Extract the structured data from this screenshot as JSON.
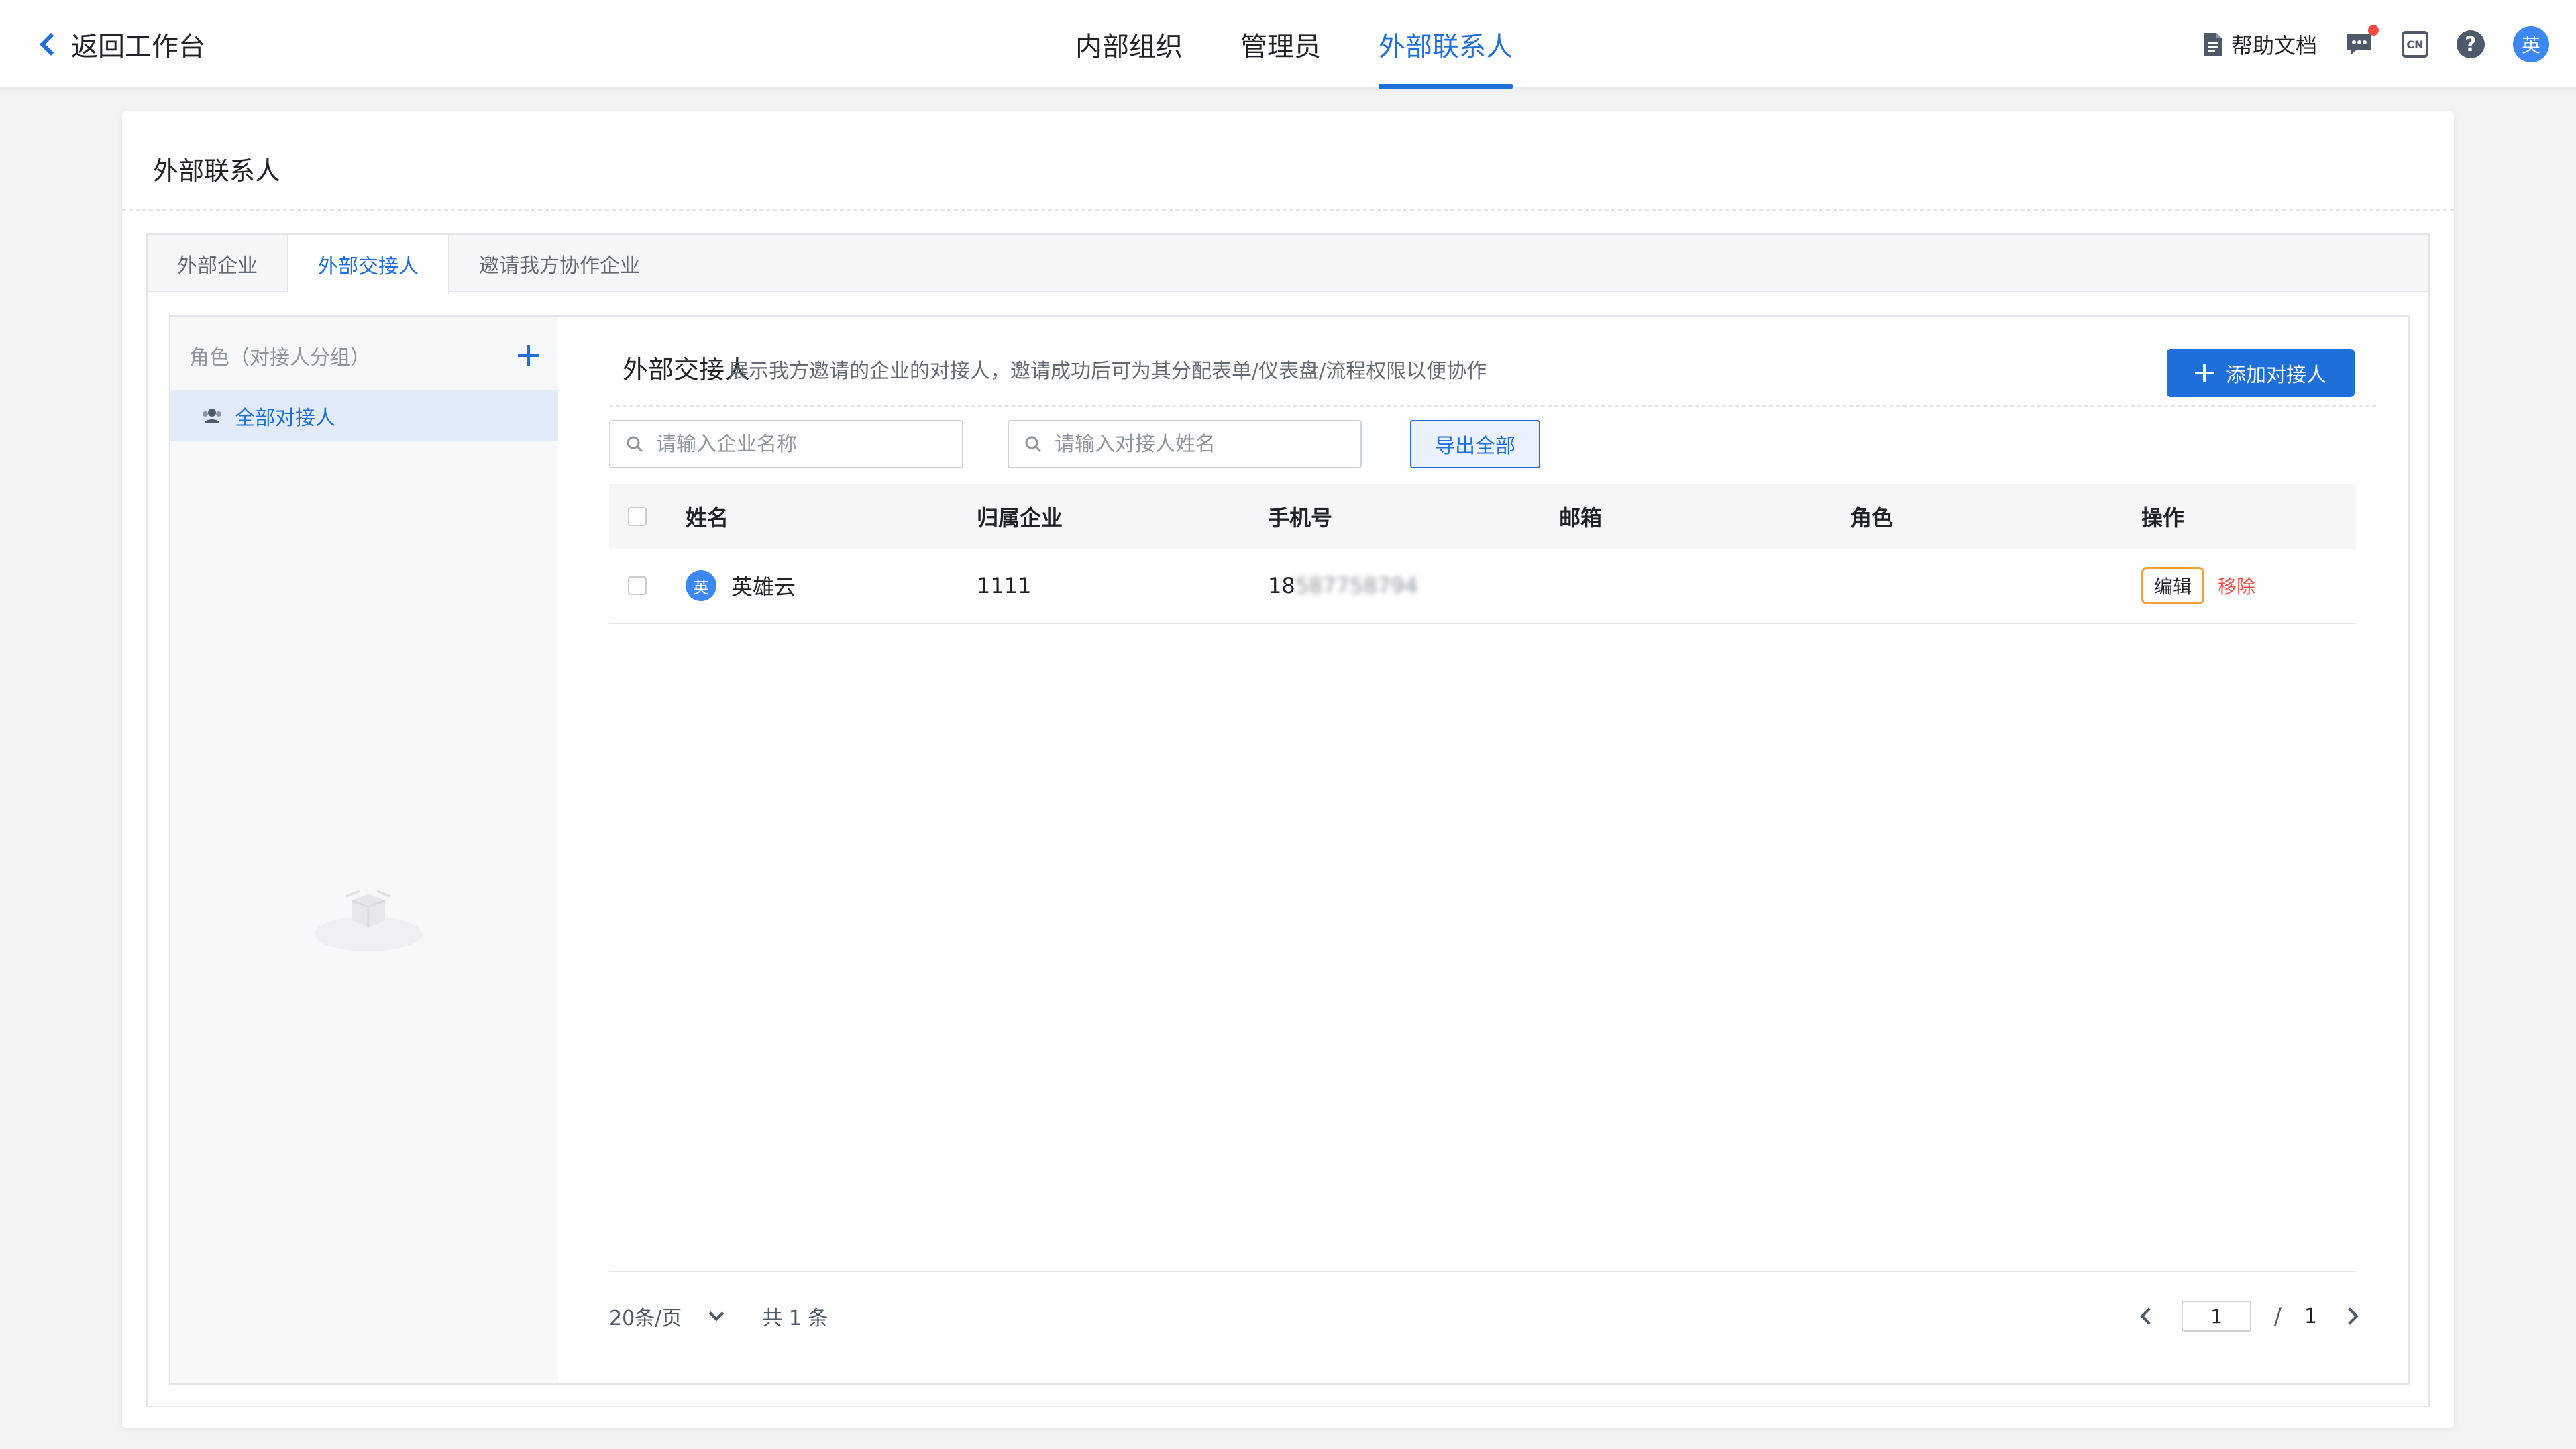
{
  "topbar": {
    "back_label": "返回工作台",
    "nav": [
      {
        "label": "内部组织",
        "active": false
      },
      {
        "label": "管理员",
        "active": false
      },
      {
        "label": "外部联系人",
        "active": true
      }
    ],
    "tools": {
      "help_doc_label": "帮助文档",
      "message_icon": "chat-icon",
      "lang_label": "CN",
      "help_label": "?",
      "avatar_text": "英"
    }
  },
  "page": {
    "title": "外部联系人",
    "tabs": [
      {
        "label": "外部企业",
        "active": false
      },
      {
        "label": "外部交接人",
        "active": true
      },
      {
        "label": "邀请我方协作企业",
        "active": false
      }
    ]
  },
  "sidebar": {
    "title": "角色（对接人分组）",
    "items": [
      {
        "label": "全部对接人",
        "icon": "users-icon",
        "active": true
      }
    ]
  },
  "content": {
    "title": "外部交接人",
    "description": "展示我方邀请的企业的对接人，邀请成功后可为其分配表单/仪表盘/流程权限以便协作",
    "add_button": "添加对接人",
    "search_company_placeholder": "请输入企业名称",
    "search_contact_placeholder": "请输入对接人姓名",
    "export_button": "导出全部",
    "columns": [
      "姓名",
      "归属企业",
      "手机号",
      "邮箱",
      "角色",
      "操作"
    ],
    "rows": [
      {
        "avatar": "英",
        "name": "英雄云",
        "company": "1111",
        "phone_prefix": "18",
        "phone_masked": "587758794",
        "email": "",
        "role": "",
        "edit": "编辑",
        "remove": "移除"
      }
    ]
  },
  "pagination": {
    "page_size": "20条/页",
    "total": "共 1 条",
    "current": "1",
    "slash": "/",
    "pages": "1"
  },
  "colors": {
    "primary": "#1e6fd9",
    "danger": "#f54a45",
    "highlight": "#f7a035"
  }
}
